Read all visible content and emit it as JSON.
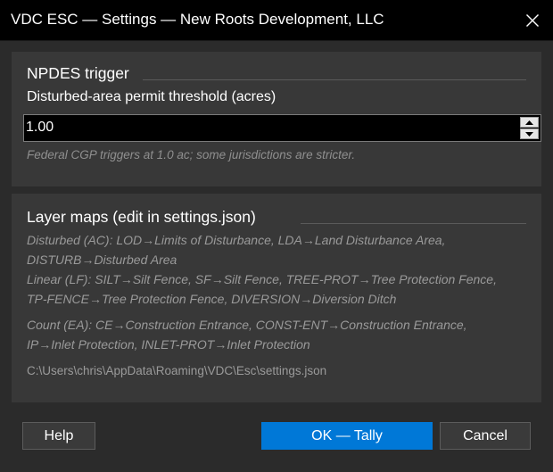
{
  "window": {
    "title": "VDC ESC — Settings — New Roots Development, LLC"
  },
  "npdes": {
    "group_title": "NPDES trigger",
    "field_label": "Disturbed-area permit threshold (acres)",
    "value": "1.00",
    "hint": "Federal CGP triggers at 1.0 ac; some jurisdictions are stricter."
  },
  "layer_maps": {
    "group_title": "Layer maps (edit in settings.json)",
    "lines": [
      "Disturbed (AC): LOD→Limits of Disturbance, LDA→Land Disturbance Area,",
      "DISTURB→Disturbed Area",
      "Linear (LF): SILT→Silt Fence, SF→Silt Fence, TREE-PROT→Tree Protection Fence,",
      "TP-FENCE→Tree Protection Fence, DIVERSION→Diversion Ditch",
      "Count (EA): CE→Construction Entrance, CONST-ENT→Construction Entrance,",
      "IP→Inlet Protection, INLET-PROT→Inlet Protection",
      "C:\\Users\\chris\\AppData\\Roaming\\VDC\\Esc\\settings.json"
    ]
  },
  "buttons": {
    "help": "Help",
    "ok": "OK — Tally",
    "cancel": "Cancel"
  },
  "icons": {
    "close": "close-icon",
    "spin_up": "caret-up-icon",
    "spin_down": "caret-down-icon"
  },
  "colors": {
    "accent": "#0078d7",
    "background": "#2b2b2b",
    "group_background": "#383838",
    "titlebar": "#000000"
  }
}
